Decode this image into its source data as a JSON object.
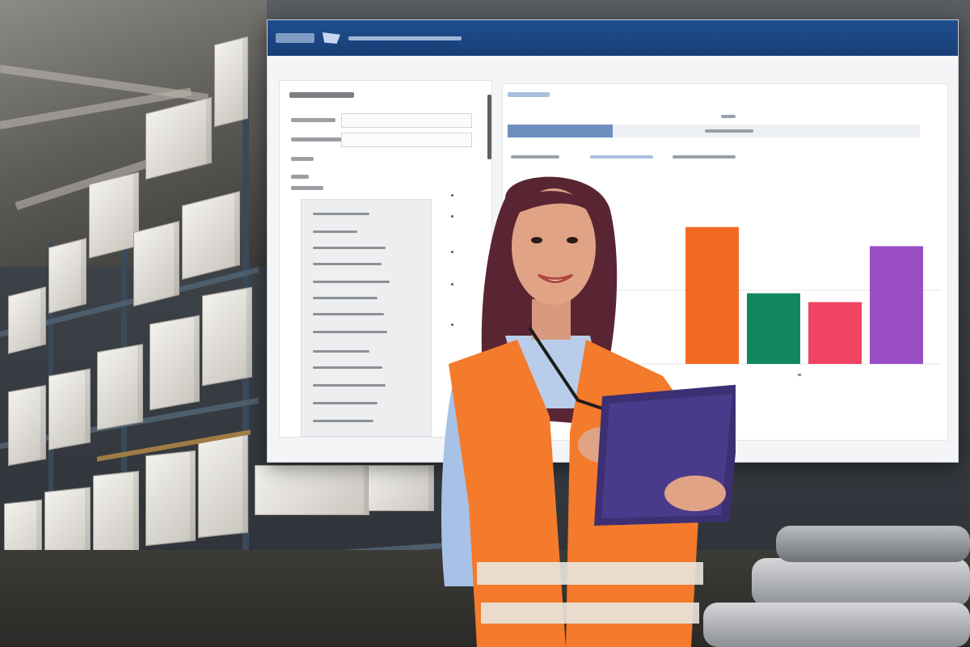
{
  "scene": {
    "description_free": true
  },
  "colors": {
    "titlebar": "#1f4e8f",
    "vest": "#f47a2c",
    "tablet": "#3c2f73"
  },
  "chart_data": {
    "type": "bar",
    "values": [
      0.93,
      0.48,
      0.42,
      0.8
    ],
    "colors": [
      "#f26a21",
      "#11875f",
      "#ef4462",
      "#9a4ec6"
    ]
  }
}
